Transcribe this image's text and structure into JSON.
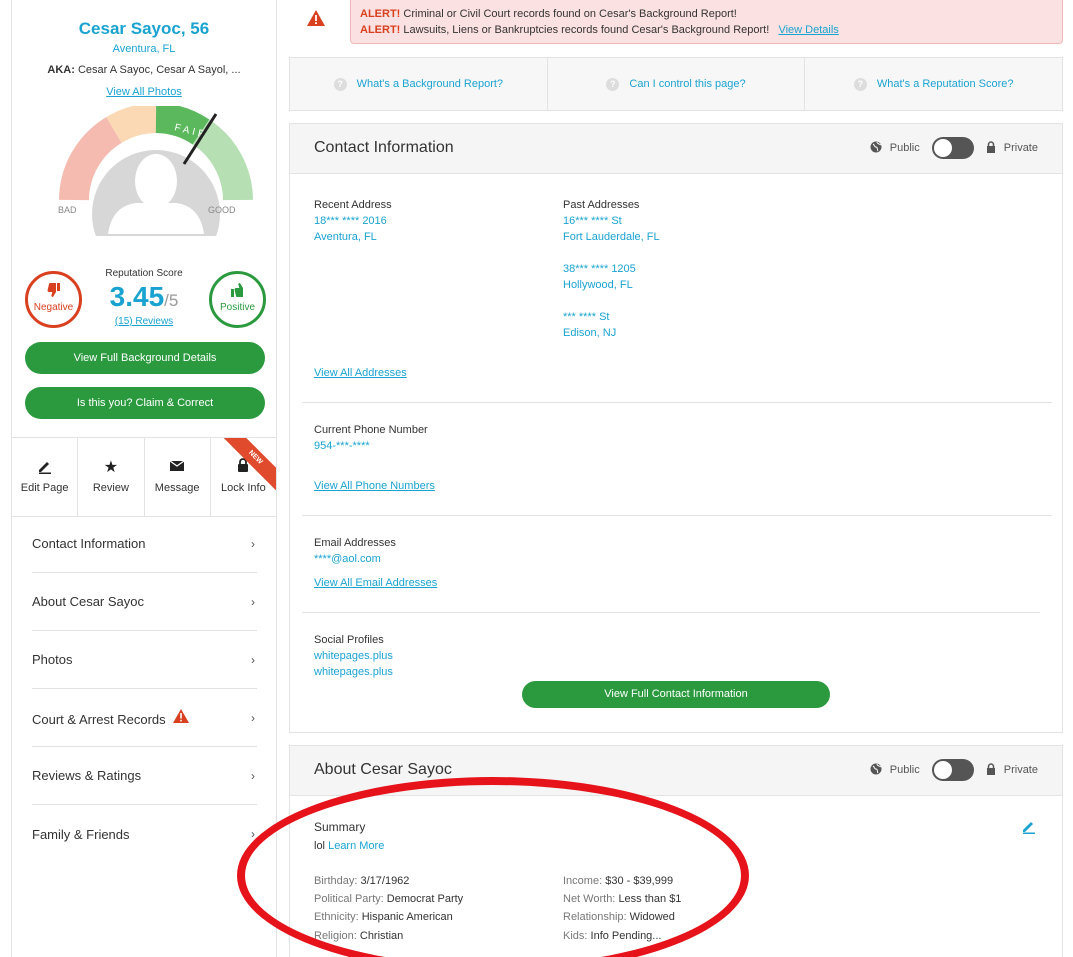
{
  "profile": {
    "name": "Cesar Sayoc, 56",
    "location": "Aventura, FL",
    "aka_label": "AKA:",
    "aka": "Cesar A Sayoc, Cesar A Sayol, ...",
    "view_photos": "View All Photos",
    "gauge": {
      "bad": "BAD",
      "good": "GOOD",
      "fair": "FAIR"
    },
    "negative": "Negative",
    "positive": "Positive",
    "rep_label": "Reputation Score",
    "rep_score": "3.45",
    "rep_max": "/5",
    "reviews": "(15) Reviews",
    "btn_background": "View Full Background Details",
    "btn_claim": "Is this you? Claim & Correct"
  },
  "actions": [
    {
      "label": "Edit Page",
      "icon": "pencil-icon"
    },
    {
      "label": "Review",
      "icon": "star-icon"
    },
    {
      "label": "Message",
      "icon": "envelope-icon"
    },
    {
      "label": "Lock Info",
      "icon": "lock-icon",
      "badge": "NEW"
    }
  ],
  "nav": [
    {
      "label": "Contact Information"
    },
    {
      "label": "About Cesar Sayoc"
    },
    {
      "label": "Photos"
    },
    {
      "label": "Court & Arrest Records",
      "warning": true
    },
    {
      "label": "Reviews & Ratings"
    },
    {
      "label": "Family & Friends"
    }
  ],
  "alert": {
    "line1_prefix": "ALERT!",
    "line1": "Criminal or Civil Court records found on Cesar's Background Report!",
    "line2_prefix": "ALERT!",
    "line2": "Lawsuits, Liens or Bankruptcies records found Cesar's Background Report!",
    "link": "View Details"
  },
  "faq": [
    {
      "label": "What's a Background Report?"
    },
    {
      "label": "Can I control this page?"
    },
    {
      "label": "What's a Reputation Score?"
    }
  ],
  "contact": {
    "title": "Contact Information",
    "public": "Public",
    "private": "Private",
    "recent_label": "Recent Address",
    "recent_line1": "18*** **** 2016",
    "recent_line2": "Aventura, FL",
    "past_label": "Past Addresses",
    "past": [
      {
        "line1": "16*** **** St",
        "line2": "Fort Lauderdale, FL"
      },
      {
        "line1": "38*** **** 1205",
        "line2": "Hollywood, FL"
      },
      {
        "line1": "*** **** St",
        "line2": "Edison, NJ"
      }
    ],
    "view_addresses": "View All Addresses",
    "phone_label": "Current Phone Number",
    "phone": "954-***-****",
    "view_phones": "View All Phone Numbers",
    "email_label": "Email Addresses",
    "email": "****@aol.com",
    "view_emails": "View All Email Addresses",
    "social_label": "Social Profiles",
    "social": [
      "whitepages.plus",
      "whitepages.plus"
    ],
    "btn_full": "View Full Contact Information"
  },
  "about": {
    "title": "About Cesar Sayoc",
    "public": "Public",
    "private": "Private",
    "summary_label": "Summary",
    "summary_text": "lol",
    "learn_more": "Learn More",
    "left": [
      {
        "k": "Birthday:",
        "v": "3/17/1962"
      },
      {
        "k": "Political Party:",
        "v": "Democrat Party"
      },
      {
        "k": "Ethnicity:",
        "v": "Hispanic American"
      },
      {
        "k": "Religion:",
        "v": "Christian"
      }
    ],
    "right": [
      {
        "k": "Income:",
        "v": "$30 - $39,999"
      },
      {
        "k": "Net Worth:",
        "v": "Less than $1"
      },
      {
        "k": "Relationship:",
        "v": "Widowed"
      },
      {
        "k": "Kids:",
        "v": "Info Pending..."
      }
    ]
  },
  "colors": {
    "accent": "#1aa3d1",
    "green": "#2b9a3f",
    "red": "#d9401f",
    "annotation": "#e6131b"
  }
}
